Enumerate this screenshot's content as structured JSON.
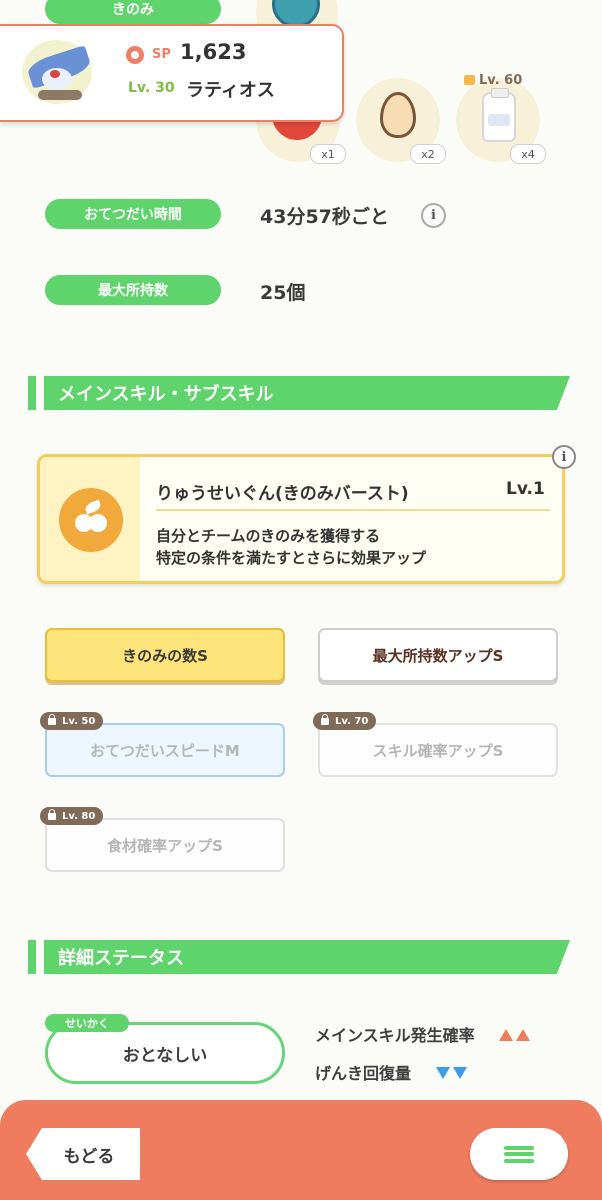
{
  "top": {
    "kinomi_label": "きのみ",
    "ingredient_counts": [
      "x1",
      "x2",
      "x4"
    ],
    "ingredient_lock_level": "Lv. 60"
  },
  "header": {
    "sp_label": "SP",
    "sp_value": "1,623",
    "level": "Lv. 30",
    "pokemon_name": "ラティオス"
  },
  "stats": {
    "help_time_label": "おてつだい時間",
    "help_time_value": "43分57秒ごと",
    "max_hold_label": "最大所持数",
    "max_hold_value": "25個"
  },
  "skills_section": {
    "title": "メインスキル・サブスキル",
    "main_skill": {
      "name": "りゅうせいぐん(きのみバースト)",
      "level": "Lv.1",
      "desc_line1": "自分とチームのきのみを獲得する",
      "desc_line2": "特定の条件を満たすとさらに効果アップ"
    },
    "sub_skills": [
      {
        "label": "きのみの数S"
      },
      {
        "label": "最大所持数アップS"
      },
      {
        "label": "おてつだいスピードM",
        "lock": "Lv. 50"
      },
      {
        "label": "スキル確率アップS",
        "lock": "Lv. 70"
      },
      {
        "label": "食材確率アップS",
        "lock": "Lv. 80"
      }
    ]
  },
  "details_section": {
    "title": "詳細ステータス",
    "nature_tag": "せいかく",
    "nature_value": "おとなしい",
    "effect_up": "メインスキル発生確率",
    "effect_down": "げんき回復量"
  },
  "footer": {
    "back_label": "もどる",
    "menu_icon": "hamburger-menu-icon"
  },
  "colors": {
    "accent_green": "#5fd36c",
    "accent_orange": "#ef7c5f",
    "skill_gold": "#f3cf59",
    "up_color": "#ef7f5a",
    "down_color": "#3f9de7"
  }
}
